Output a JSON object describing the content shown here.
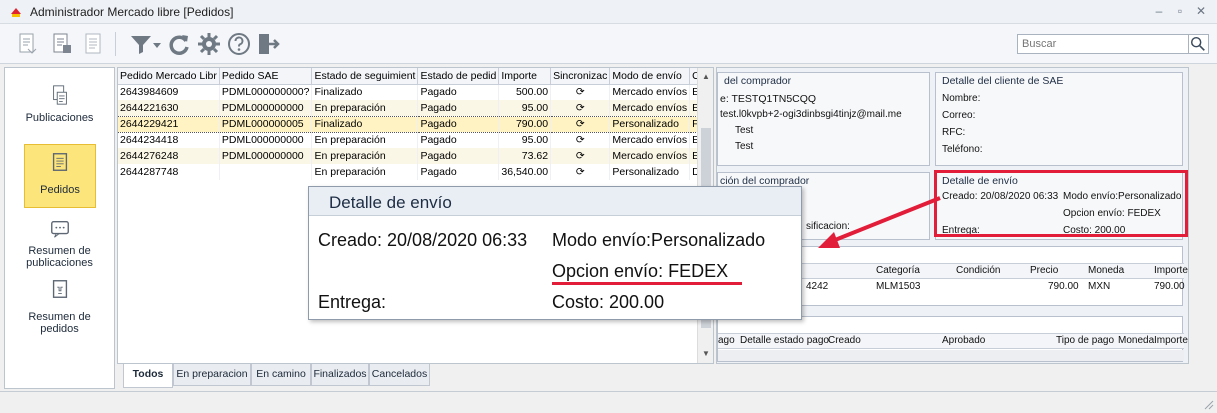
{
  "window": {
    "title": "Administrador Mercado libre [Pedidos]"
  },
  "toolbar": {
    "search_placeholder": "Buscar"
  },
  "sidebar": {
    "items": [
      {
        "label": "Publicaciones",
        "icon": "publications-icon"
      },
      {
        "label": "Pedidos",
        "icon": "orders-icon"
      },
      {
        "label1": "Resumen de",
        "label2": "publicaciones",
        "icon": "chat-icon"
      },
      {
        "label1": "Resumen de",
        "label2": "pedidos",
        "icon": "receipt-icon"
      }
    ]
  },
  "grid": {
    "columns": [
      "Pedido Mercado Libr",
      "Pedido SAE",
      "Estado de seguimient",
      "Estado de pedid",
      "Importe",
      "Sincronizac",
      "Modo de envío",
      "Opción de env"
    ],
    "rows": [
      [
        "2643984609",
        "PDML000000000?",
        "Finalizado",
        "Pagado",
        "500.00",
        "Mercado envíos",
        "Estándar a dom"
      ],
      [
        "2644221630",
        "PDML000000000",
        "En preparación",
        "Pagado",
        "95.00",
        "Mercado envíos",
        "Estándar a dom"
      ],
      [
        "2644229421",
        "PDML000000005",
        "Finalizado",
        "Pagado",
        "790.00",
        "Personalizado",
        "FEDEX"
      ],
      [
        "2644234418",
        "PDML000000000",
        "En preparación",
        "Pagado",
        "95.00",
        "Mercado envíos",
        "Estándar a dom"
      ],
      [
        "2644276248",
        "PDML000000000",
        "En preparación",
        "Pagado",
        "73.62",
        "Mercado envíos",
        "Estándar a dom"
      ],
      [
        "2644287748",
        "",
        "En preparación",
        "Pagado",
        "36,540.00",
        "Personalizado",
        "DHL"
      ]
    ]
  },
  "tabs": [
    "Todos",
    "En preparacion",
    "En camino",
    "Finalizados",
    "Cancelados"
  ],
  "buyer": {
    "title": "del comprador",
    "line1": "e:  TESTQ1TN5CQQ",
    "line2": "test.l0kvpb+2-ogi3dinbsgi4tinjz@mail.me",
    "line3": "Test",
    "line4": "Test"
  },
  "sae_client": {
    "title": "Detalle del cliente de SAE",
    "nombre": "Nombre:",
    "correo": "Correo:",
    "rfc": "RFC:",
    "telefono": "Teléfono:"
  },
  "buyer2": {
    "title": "ción del comprador",
    "label": "sificacion:"
  },
  "shipping": {
    "title": "Detalle de envío",
    "created": "Creado: 20/08/2020 06:33",
    "mode": "Modo envío:Personalizado",
    "option": "Opcion envío: FEDEX",
    "delivery": "Entrega:",
    "cost": "Costo: 200.00"
  },
  "items_table": {
    "columns": [
      "Categoría",
      "Condición",
      "Precio",
      "Moneda",
      "Importe"
    ],
    "row": {
      "partial": "4242",
      "category": "MLM1503",
      "condition": "",
      "price": "790.00",
      "currency": "MXN",
      "amount": "790.00"
    }
  },
  "payments_table": {
    "columns": [
      "ago",
      "Detalle estado pago",
      "Creado",
      "Aprobado",
      "Tipo de pago",
      "Moneda",
      "Importe"
    ]
  },
  "popup": {
    "title": "Detalle de envío",
    "created": "Creado: 20/08/2020 06:33",
    "mode": "Modo envío:Personalizado",
    "option": "Opcion envío: FEDEX",
    "delivery": "Entrega:",
    "cost": "Costo: 200.00"
  },
  "colors": {
    "highlight": "#e21d3a",
    "selected_row": "#fff3c4",
    "active_tab": "#fce57b"
  }
}
